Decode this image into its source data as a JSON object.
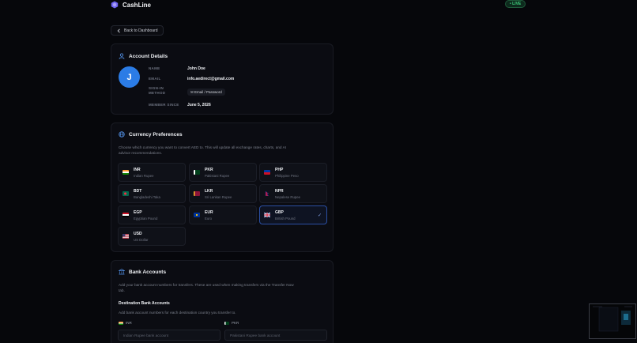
{
  "app": {
    "name": "CashLine",
    "live_label": "• LIVE"
  },
  "nav": {
    "back_label": "Back to Dashboard"
  },
  "account": {
    "title": "Account Details",
    "avatar_initial": "J",
    "name_label": "NAME",
    "name_value": "John Doe",
    "email_label": "EMAIL",
    "email_value": "info.aedirect@gmail.com",
    "signin_label_1": "SIGN-IN",
    "signin_label_2": "METHOD",
    "signin_value": "Email / Password",
    "member_label": "MEMBER SINCE",
    "member_value": "June 5, 2026"
  },
  "currency": {
    "title": "Currency Preferences",
    "desc_line1": "Choose which currency you want to convert AED to. This will update all exchange rates, charts, and AI",
    "desc_line2": "advisor recommendations.",
    "selected": "GBP",
    "items": [
      {
        "code": "INR",
        "name": "Indian Rupee"
      },
      {
        "code": "PKR",
        "name": "Pakistani Rupee"
      },
      {
        "code": "PHP",
        "name": "Philippine Peso"
      },
      {
        "code": "BDT",
        "name": "Bangladeshi Taka"
      },
      {
        "code": "LKR",
        "name": "Sri Lankan Rupee"
      },
      {
        "code": "NPR",
        "name": "Nepalese Rupee"
      },
      {
        "code": "EGP",
        "name": "Egyptian Pound"
      },
      {
        "code": "EUR",
        "name": "Euro"
      },
      {
        "code": "GBP",
        "name": "British Pound"
      },
      {
        "code": "USD",
        "name": "US Dollar"
      }
    ]
  },
  "bank": {
    "title": "Bank Accounts",
    "desc_line1": "Add your bank account numbers for transfers. These are used when making transfers via the Transfer Now",
    "desc_line2": "tab.",
    "dest_title": "Destination Bank Accounts",
    "dest_desc": "Add bank account numbers for each destination country you transfer to.",
    "fields": [
      {
        "code": "INR",
        "placeholder": "Indian Rupee bank account"
      },
      {
        "code": "PKR",
        "placeholder": "Pakistani Rupee bank account"
      }
    ]
  },
  "colors": {
    "accent": "#2b7ce6",
    "live": "#3fd17e",
    "selected_border": "#2b4fa3"
  }
}
